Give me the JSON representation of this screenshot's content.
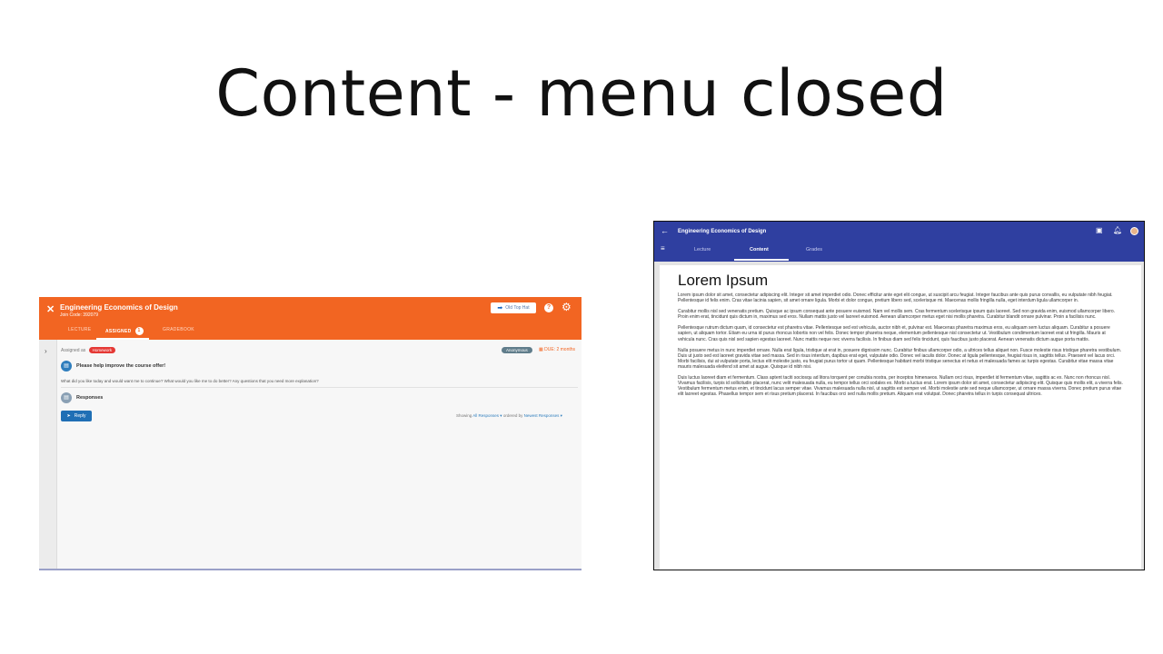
{
  "slide": {
    "title": "Content - menu closed"
  },
  "left_app": {
    "close_glyph": "✕",
    "course_title": "Engineering Economics of Design",
    "join_label": "Join Code:",
    "join_code": "392079",
    "old_top_hat_label": "Old Top Hat",
    "help_glyph": "?",
    "gear_glyph": "⚙",
    "tabs": [
      {
        "label": "LECTURE"
      },
      {
        "label": "ASSIGNED",
        "badge": "1"
      },
      {
        "label": "GRADEBOOK"
      }
    ],
    "assigned_as_label": "Assigned as",
    "homework_badge": "Homework",
    "anonymous_badge": "Anonymous",
    "due_text": "DUE: 2 months",
    "question_title": "Please help improve the course offer!",
    "question_text": "What did you like today and would want me to continue? What would you like me to do better? Any questions that you need more explanation?",
    "responses_title": "Responses",
    "reply_label": "Reply",
    "showing_label": "Showing",
    "showing_value": "All Responses",
    "ordered_label": "ordered by",
    "ordered_value": "Newest Responses",
    "accent_color": "#f26522"
  },
  "right_app": {
    "back_glyph": "←",
    "course_title": "Engineering Economics of Design",
    "menu_glyph": "≡",
    "tabs": [
      {
        "label": "Lecture"
      },
      {
        "label": "Content"
      },
      {
        "label": "Grades"
      }
    ],
    "active_tab": "Content",
    "content_heading": "Lorem Ipsum",
    "paragraphs": [
      "Lorem ipsum dolor sit amet, consectetur adipiscing elit. Integer sit amet imperdiet odio. Donec efficitur ante eget elit congue, ut suscipit arcu feugiat. Integer faucibus ante quis purus convallis, eu vulputate nibh feugiat. Pellentesque id felis enim. Cras vitae lacinia sapien, sit amet ornare ligula. Morbi et dolor congue, pretium libero sed, scelerisque mi. Maecenas mollis fringilla nulla, eget interdum ligula ullamcorper in.",
      "Curabitur mollis nisl sed venenatis pretium. Quisque ac ipsum consequat ante posuere euismod. Nam vel mollis sem. Cras fermentum scelerisque ipsum quis laoreet. Sed non gravida enim, euismod ullamcorper libero. Proin enim erat, tincidunt quis dictum in, maximus sed eros. Nullam mattis justo vel laoreet euismod. Aenean ullamcorper metus eget nisi mollis pharetra. Curabitur blandit ornare pulvinar. Proin a facilisis nunc.",
      "Pellentesque rutrum dictum quam, id consectetur est pharetra vitae. Pellentesque sed est vehicula, auctor nibh et, pulvinar est. Maecenas pharetra maximus eros, eu aliquam sem luctus aliquam. Curabitur a posuere sapien, ut aliquam tortor. Etiam eu urna id purus rhoncus lobortis non vel felis. Donec tempor pharetra neque, elementum pellentesque nisl consectetur ut. Vestibulum condimentum laoreet erat ut fringilla. Mauris at vehicula nunc. Cras quis nisl sed sapien egestas laoreet. Nunc mattis neque nec viverra facilisis. In finibus diam sed felis tincidunt, quis faucibus justo placerat. Aenean venenatis dictum augue porta mattis.",
      "Nulla posuere metus in nunc imperdiet ornare. Nulla erat ligula, tristique at erat in, posuere dignissim nunc. Curabitur finibus ullamcorper odio, a ultrices tellus aliquet non. Fusce molestie risus tristique pharetra vestibulum. Duis ut justo sed est laoreet gravida vitae sed massa. Sed in risus interdum, dapibus erat eget, vulputate odio. Donec vel iaculis dolor. Donec at ligula pellentesque, feugiat risus in, sagittis tellus. Praesent vel lacus orci. Morbi facilisis, dui at vulputate porta, lectus elit molestie justo, eu feugiat purus tortor ut quam. Pellentesque habitant morbi tristique senectus et netus et malesuada fames ac turpis egestas. Curabitur vitae massa vitae mauris malesuada eleifend sit amet at augue. Quisque id nibh nisi.",
      "Duis luctus laoreet diam et fermentum. Class aptent taciti sociosqu ad litora torquent per conubia nostra, per inceptos himenaeos. Nullam orci risus, imperdiet id fermentum vitae, sagittis ac ex. Nunc non rhoncus nisl. Vivamus facilisis, turpis id sollicitudin placerat, nunc velit malesuada nulla, eu tempor tellus orci sodales ex. Morbi a luctus erat. Lorem ipsum dolor sit amet, consectetur adipiscing elit. Quisque quis mollis elit, a viverra felis. Vestibulum fermentum metus enim, et tincidunt lacus semper vitae. Vivamus malesuada nulla nisl, ut sagittis est semper vel. Morbi molestie ante sed neque ullamcorper, ut ornare massa viverra. Donec pretium purus vitae elit laoreet egestas. Phasellus tempor sem et risus pretium placerat. In faucibus orci sed nulla mollis pretium. Aliquam erat volutpat. Donec pharetra tellus in turpis consequat ultrices."
    ],
    "accent_color": "#2f3fa0"
  }
}
